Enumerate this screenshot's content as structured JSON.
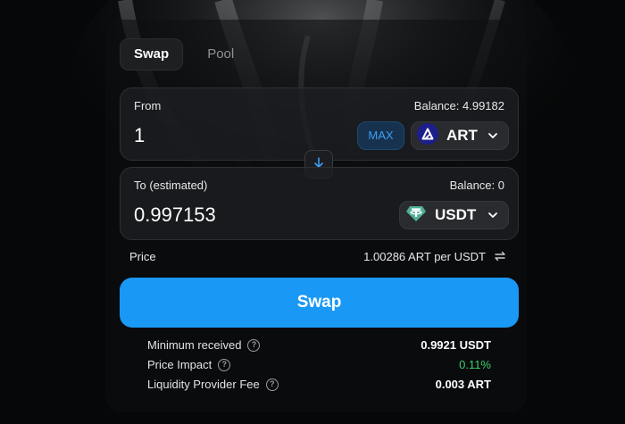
{
  "tabs": [
    {
      "label": "Swap",
      "active": true
    },
    {
      "label": "Pool",
      "active": false
    }
  ],
  "from": {
    "label": "From",
    "balance": "Balance: 4.99182",
    "amount": "1",
    "max_label": "MAX",
    "token": "ART",
    "token_icon": "art-token-icon"
  },
  "to": {
    "label": "To (estimated)",
    "balance": "Balance: 0",
    "amount": "0.997153",
    "token": "USDT",
    "token_icon": "tether-token-icon"
  },
  "price": {
    "label": "Price",
    "value": "1.00286 ART per USDT"
  },
  "swap_button": "Swap",
  "details": [
    {
      "label": "Minimum received",
      "value": "0.9921 USDT",
      "value_color": "#ffffff"
    },
    {
      "label": "Price Impact",
      "value": "0.11%",
      "value_color": "#3ecf6b"
    },
    {
      "label": "Liquidity Provider Fee",
      "value": "0.003 ART",
      "value_color": "#ffffff"
    }
  ],
  "colors": {
    "accent": "#1a98f6",
    "background": "#060708",
    "max_text": "#3d9df2",
    "positive": "#3ecf6b"
  }
}
